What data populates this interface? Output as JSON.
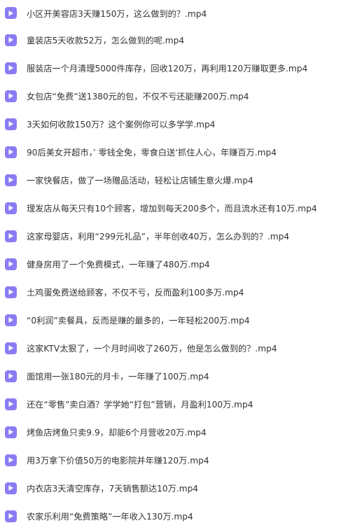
{
  "accent_color": "#8a7cf4",
  "icon": "video-file-icon",
  "files": [
    {
      "name": "小区开美容店3天赚150万，这么做到的？.mp4"
    },
    {
      "name": "童装店5天收款52万，怎么做到的呢.mp4"
    },
    {
      "name": "服装店一个月清理5000件库存，回收120万，再利用120万赚取更多.mp4"
    },
    {
      "name": "女包店“免费”送1380元的包，不仅不亏还能赚200万.mp4"
    },
    {
      "name": "3天如何收款150万？这个案例你可以多学学.mp4"
    },
    {
      "name": "90后美女开超市，’ 零钱全免，零食白送‘抓住人心，年赚百万.mp4"
    },
    {
      "name": "一家快餐店，做了一场赠品活动，轻松让店铺生意火爆.mp4"
    },
    {
      "name": "理发店从每天只有10个顾客，增加到每天200多个，而且流水还有10万.mp4"
    },
    {
      "name": "这家母婴店，利用“299元礼品”，半年创收40万，怎么办到的？.mp4"
    },
    {
      "name": "健身房用了一个免费模式，一年赚了480万.mp4"
    },
    {
      "name": "土鸡蛋免费送给顾客，不仅不亏，反而盈利100多万.mp4"
    },
    {
      "name": "“0利润”卖餐具，反而是赚的最多的，一年轻松200万.mp4"
    },
    {
      "name": "这家KTV太狠了，一个月时间收了260万，他是怎么做到的？.mp4"
    },
    {
      "name": "面馆用一张180元的月卡，一年赚了100万.mp4"
    },
    {
      "name": "还在“零售”卖白酒？学学她“打包”营销，月盈利100万.mp4"
    },
    {
      "name": "烤鱼店烤鱼只卖9.9，却能6个月营收20万.mp4"
    },
    {
      "name": "用3万拿下价值50万的电影院并年赚120万.mp4"
    },
    {
      "name": "内衣店3天清空库存，7天销售额达10万.mp4"
    },
    {
      "name": "农家乐利用“免费策略”一年收入130万.mp4"
    }
  ]
}
